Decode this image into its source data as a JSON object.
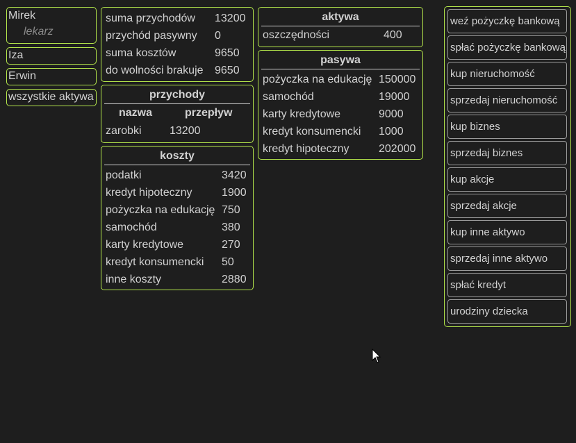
{
  "players": {
    "active": {
      "name": "Mirek",
      "profession": "lekarz"
    },
    "others": [
      "Iza",
      "Erwin"
    ],
    "all_assets_label": "wszystkie aktywa"
  },
  "summary": {
    "rows": [
      {
        "label": "suma przychodów",
        "value": "13200"
      },
      {
        "label": "przychód pasywny",
        "value": "0"
      },
      {
        "label": "suma kosztów",
        "value": "9650"
      },
      {
        "label": "do wolności brakuje",
        "value": "9650"
      }
    ]
  },
  "income": {
    "title": "przychody",
    "col_name": "nazwa",
    "col_flow": "przepływ",
    "rows": [
      {
        "label": "zarobki",
        "value": "13200"
      }
    ]
  },
  "costs": {
    "title": "koszty",
    "rows": [
      {
        "label": "podatki",
        "value": "3420"
      },
      {
        "label": "kredyt hipoteczny",
        "value": "1900"
      },
      {
        "label": "pożyczka na edukację",
        "value": "750"
      },
      {
        "label": "samochód",
        "value": "380"
      },
      {
        "label": "karty kredytowe",
        "value": "270"
      },
      {
        "label": "kredyt konsumencki",
        "value": "50"
      },
      {
        "label": "inne koszty",
        "value": "2880"
      }
    ]
  },
  "assets": {
    "title": "aktywa",
    "rows": [
      {
        "label": "oszczędności",
        "value": "400"
      }
    ]
  },
  "liabilities": {
    "title": "pasywa",
    "rows": [
      {
        "label": "pożyczka na edukację",
        "value": "150000"
      },
      {
        "label": "samochód",
        "value": "19000"
      },
      {
        "label": "karty kredytowe",
        "value": "9000"
      },
      {
        "label": "kredyt konsumencki",
        "value": "1000"
      },
      {
        "label": "kredyt hipoteczny",
        "value": "202000"
      }
    ]
  },
  "actions": [
    "weź pożyczkę bankową",
    "spłać pożyczkę bankową",
    "kup nieruchomość",
    "sprzedaj nieruchomość",
    "kup biznes",
    "sprzedaj biznes",
    "kup akcje",
    "sprzedaj akcje",
    "kup inne aktywo",
    "sprzedaj inne aktywo",
    "spłać kredyt",
    "urodziny dziecka"
  ],
  "colors": {
    "background": "#1e1e1e",
    "border_accent": "#b4e64b",
    "button_border": "#9a9a9a",
    "text": "#d2d2d2"
  }
}
